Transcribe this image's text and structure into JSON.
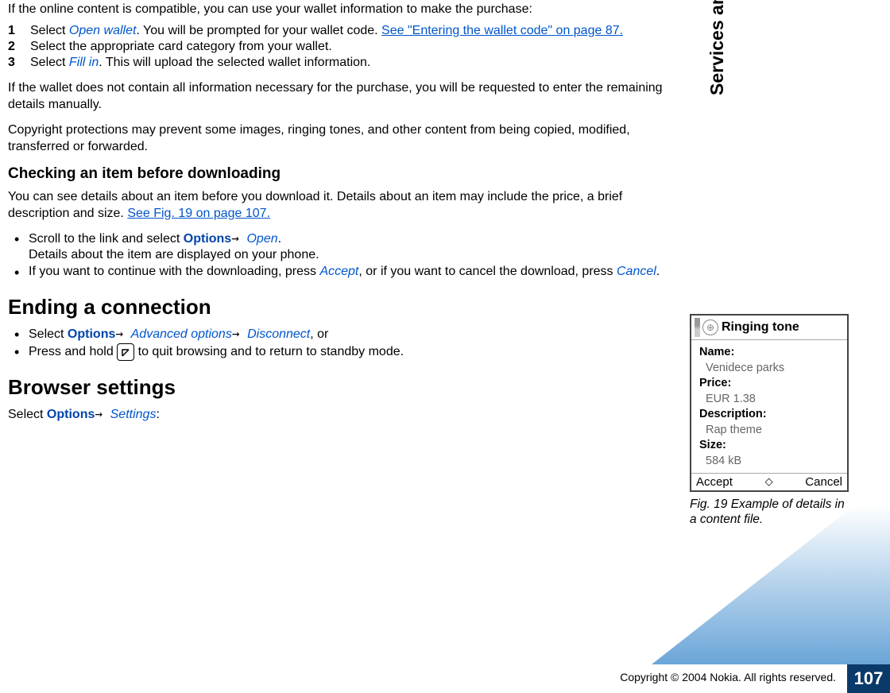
{
  "intro": "If the online content is compatible, you can use your wallet information to make the purchase:",
  "steps": {
    "s1_before": "Select ",
    "s1_action": "Open wallet",
    "s1_after": ". You will be prompted for your wallet code. ",
    "s1_link": "See \"Entering the wallet code\" on page 87.",
    "s2": "Select the appropriate card category from your wallet.",
    "s3_before": "Select ",
    "s3_action": "Fill in",
    "s3_after": ". This will upload the selected wallet information."
  },
  "wallet_note": "If the wallet does not contain all information necessary for the purchase, you will be requested to enter the remaining details manually.",
  "copyright_note": "Copyright protections may prevent some images, ringing tones, and other content from being copied, modified, transferred or forwarded.",
  "checking_heading": "Checking an item before downloading",
  "checking_intro_before": "You can see details about an item before you download it. Details about an item may include the price, a brief description and size. ",
  "checking_intro_link": "See Fig. 19 on page 107.",
  "checking_bullets": {
    "b1_before": "Scroll to the link and select ",
    "b1_options": "Options",
    "b1_arrow": "→ ",
    "b1_open": "Open",
    "b1_after": ".",
    "b1_line2": "Details about the item are displayed on your phone.",
    "b2_before": "If you want to continue with the downloading, press ",
    "b2_accept": "Accept",
    "b2_mid": ", or if you want to cancel the download, press ",
    "b2_cancel": "Cancel",
    "b2_after": "."
  },
  "ending_heading": "Ending a connection",
  "ending_bullets": {
    "b1_before": "Select ",
    "b1_options": "Options",
    "b1_arrow1": "→ ",
    "b1_adv": "Advanced options",
    "b1_arrow2": "→ ",
    "b1_disc": "Disconnect",
    "b1_after": ", or",
    "b2_before": "Press and hold ",
    "b2_after": " to quit browsing and to return to standby mode."
  },
  "browser_heading": "Browser settings",
  "browser_line_before": "Select ",
  "browser_options": "Options",
  "browser_arrow": "→ ",
  "browser_settings": "Settings",
  "browser_after": ":",
  "figure": {
    "title": "Ringing tone",
    "name_label": "Name:",
    "name_value": "Venidece parks",
    "price_label": "Price:",
    "price_value": "EUR 1.38",
    "desc_label": "Description:",
    "desc_value": "Rap theme",
    "size_label": "Size:",
    "size_value": "584 kB",
    "left_softkey": "Accept",
    "right_softkey": "Cancel",
    "caption": "Fig. 19 Example of details in a content file."
  },
  "side_tab": "Services and Applications",
  "page_number": "107",
  "copyright": "Copyright © 2004 Nokia. All rights reserved.",
  "numbers": {
    "one": "1",
    "two": "2",
    "three": "3"
  }
}
